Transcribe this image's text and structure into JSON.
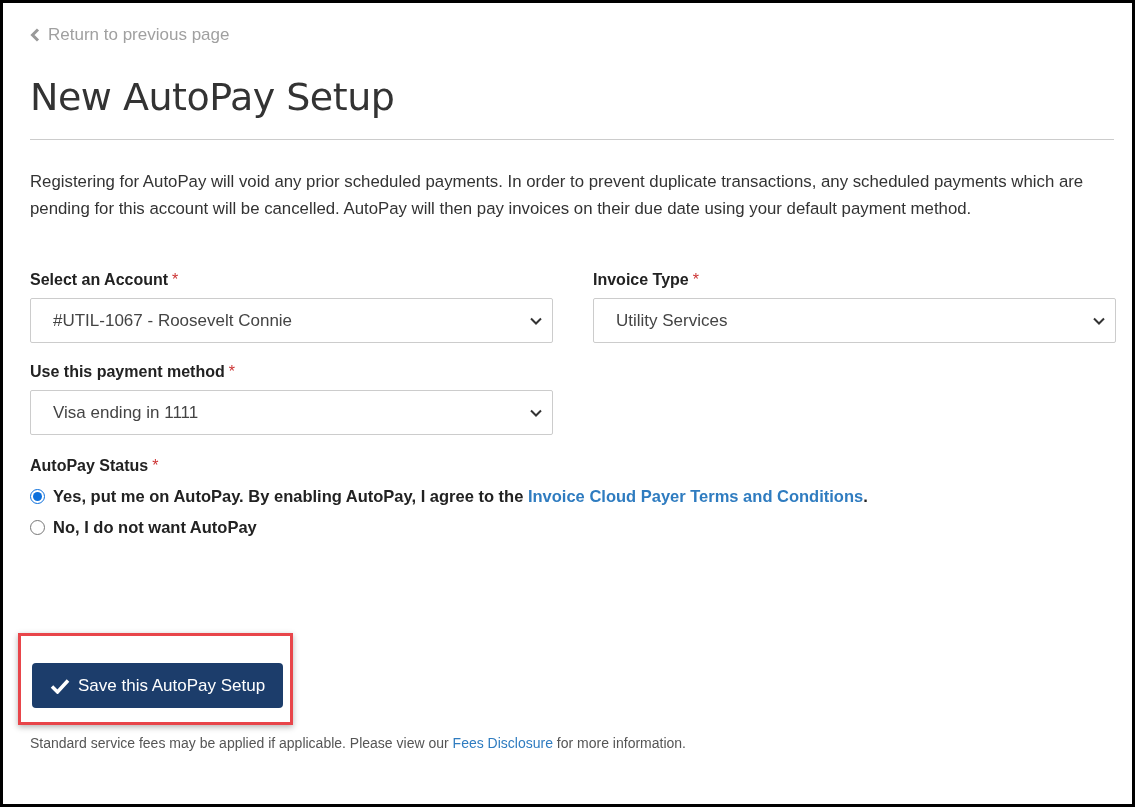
{
  "back_link": {
    "label": "Return to previous page"
  },
  "title": "New AutoPay Setup",
  "notice": "Registering for AutoPay will void any prior scheduled payments. In order to prevent duplicate transactions, any scheduled payments which are pending for this account will be cancelled. AutoPay will then pay invoices on their due date using your default payment method.",
  "fields": [
    {
      "label": "Select an Account",
      "required_mark": "*",
      "value": "#UTIL-1067 - Roosevelt Connie"
    },
    {
      "label": "Invoice Type",
      "required_mark": "*",
      "value": "Utility Services"
    },
    {
      "label": "Use this payment method",
      "required_mark": "*",
      "value": "Visa ending in 1111"
    }
  ],
  "autopay_status": {
    "label": "AutoPay Status",
    "required_mark": "*",
    "options": [
      {
        "label": "Yes, put me on AutoPay. By enabling AutoPay, I agree to the",
        "link": "Invoice Cloud Payer Terms and Conditions",
        "suffix": ".",
        "selected": true
      },
      {
        "label": "No, I do not want AutoPay",
        "selected": false
      }
    ]
  },
  "save_button": {
    "label": "Save this AutoPay Setup",
    "highlighted": true
  },
  "footer": {
    "before": "Standard service fees may be applied if applicable. Please view our",
    "link": "Fees Disclosure",
    "after": "for more information."
  }
}
